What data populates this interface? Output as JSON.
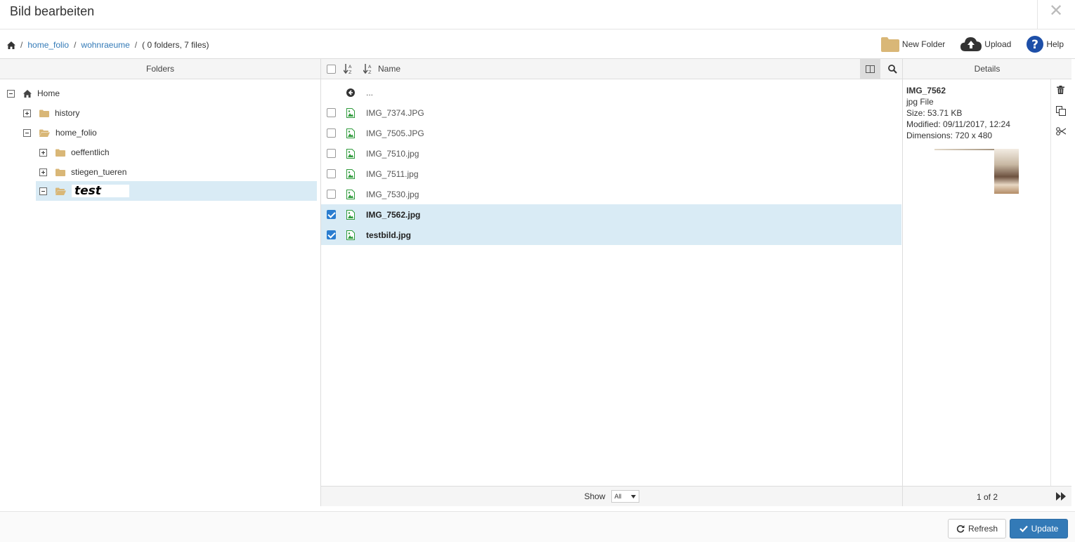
{
  "dialog": {
    "title": "Bild bearbeiten",
    "close_glyph": "✕"
  },
  "breadcrumb": {
    "items": [
      "home_folio",
      "wohnraeume"
    ],
    "separator": "/",
    "info": "( 0 folders, 7 files)"
  },
  "toolbar": {
    "new_folder": "New Folder",
    "upload": "Upload",
    "help": "Help"
  },
  "panels": {
    "folders": "Folders",
    "details": "Details"
  },
  "tree": {
    "root": "Home",
    "items": [
      {
        "label": "history"
      },
      {
        "label": "home_folio"
      },
      {
        "label": "oeffentlich"
      },
      {
        "label": "stiegen_tueren"
      }
    ],
    "editing_value": "test"
  },
  "files": {
    "header_name": "Name",
    "parent_label": "...",
    "rows": [
      {
        "name": "IMG_7374.JPG",
        "checked": false
      },
      {
        "name": "IMG_7505.JPG",
        "checked": false
      },
      {
        "name": "IMG_7510.jpg",
        "checked": false
      },
      {
        "name": "IMG_7511.jpg",
        "checked": false
      },
      {
        "name": "IMG_7530.jpg",
        "checked": false
      },
      {
        "name": "IMG_7562.jpg",
        "checked": true
      },
      {
        "name": "testbild.jpg",
        "checked": true
      }
    ],
    "show_label": "Show",
    "show_value": "All"
  },
  "details": {
    "name": "IMG_7562",
    "type": "jpg File",
    "size": "Size: 53.71 KB",
    "modified": "Modified: 09/11/2017, 12:24",
    "dimensions": "Dimensions: 720 x 480",
    "pager": "1 of 2"
  },
  "buttons": {
    "refresh": "Refresh",
    "update": "Update"
  },
  "colors": {
    "accent": "#337ab7",
    "selected_row": "#d9ebf5",
    "folder": "#d9b777",
    "file_icon": "#2e9b3b"
  }
}
